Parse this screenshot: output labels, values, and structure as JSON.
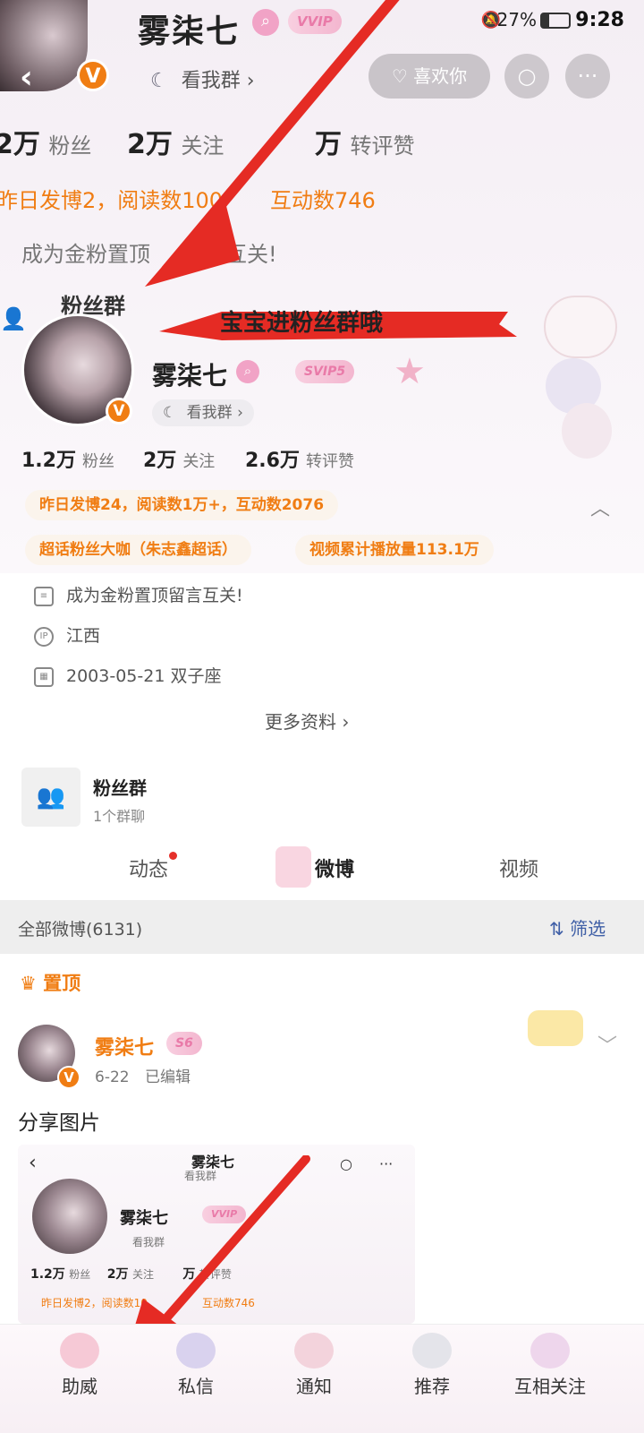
{
  "status_bar": {
    "battery": "27%",
    "time": "9:28"
  },
  "header": {
    "name": "雾柒七",
    "vip_label": "VVIP",
    "verified": "V",
    "view_group": "看我群",
    "like_button": "喜欢你"
  },
  "top_stats": {
    "fans_num": "2万",
    "fans_label": "粉丝",
    "follow_num": "2万",
    "follow_label": "关注",
    "repost_num": "万",
    "repost_label": "转评赞"
  },
  "top_summary": "昨日发博2，阅读数100",
  "top_summary_tail": "互动数746",
  "top_pin_note": "成为金粉置顶",
  "top_pin_tail": "互关!",
  "fan_group_top_label": "粉丝群",
  "annotation_text": "宝宝进粉丝群哦",
  "profile": {
    "name": "雾柒七",
    "vip_label": "SVIP5",
    "verified": "V",
    "view_group": "看我群",
    "fans_num": "1.2万",
    "fans_label": "粉丝",
    "follow_num": "2万",
    "follow_label": "关注",
    "repost_num": "2.6万",
    "repost_label": "转评赞",
    "yesterday": "昨日发博24，阅读数1万+，互动数2076",
    "super_topic": "超话粉丝大咖（朱志鑫超话）",
    "video_plays": "视频累计播放量113.1万",
    "pin_note": "成为金粉置顶留言互关!",
    "ip_region": "江西",
    "birthday": "2003-05-21 双子座",
    "more_info": "更多资料"
  },
  "fan_group": {
    "title": "粉丝群",
    "subtitle": "1个群聊"
  },
  "tabs": {
    "dynamic": "动态",
    "weibo": "微博",
    "video": "视频"
  },
  "filter": {
    "all_posts": "全部微博(6131)",
    "filter_label": "筛选"
  },
  "pinned": {
    "label": "置顶"
  },
  "post": {
    "author": "雾柒七",
    "level": "S6",
    "date": "6-22",
    "edited": "已编辑",
    "text": "分享图片"
  },
  "embed": {
    "title": "雾柒七",
    "view_group": "看我群",
    "name": "雾柒七",
    "vip": "VVIP",
    "view_group2": "看我群",
    "fans_num": "1.2万",
    "fans_label": "粉丝",
    "follow_num": "2万",
    "follow_label": "关注",
    "repost_num": "万",
    "repost_label": "转评赞",
    "summary": "昨日发博2，阅读数10",
    "summary_tail": "互动数746"
  },
  "bottom_nav": {
    "assist": "助威",
    "dm": "私信",
    "notify": "通知",
    "recommend": "推荐",
    "mutual": "互相关注"
  },
  "colors": {
    "accent_orange": "#f07d13",
    "arrow_red": "#e52b24",
    "vip_pink": "#e97aa8"
  }
}
